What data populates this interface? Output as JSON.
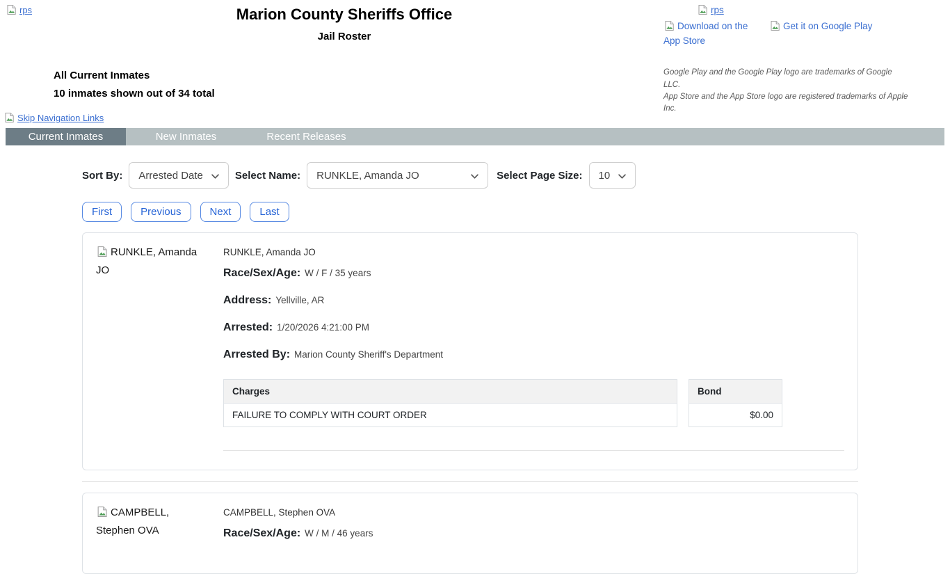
{
  "header": {
    "logo_alt": "rps",
    "title": "Marion County Sheriffs Office",
    "subtitle": "Jail Roster",
    "store_rps_alt": "rps",
    "app_store_alt": "Download on the App Store",
    "google_play_alt": "Get it on Google Play",
    "trademark_line1": "Google Play and the Google Play logo are trademarks of Google LLC.",
    "trademark_line2": "App Store and the App Store logo are registered trademarks of Apple Inc."
  },
  "summary": {
    "heading": "All Current Inmates",
    "count_text": "10 inmates shown out of 34 total"
  },
  "skip_link_label": "Skip Navigation Links",
  "tabs": [
    {
      "label": "Current Inmates",
      "active": true
    },
    {
      "label": "New Inmates",
      "active": false
    },
    {
      "label": "Recent Releases",
      "active": false
    }
  ],
  "controls": {
    "sort_by_label": "Sort By:",
    "sort_by_value": "Arrested Date",
    "select_name_label": "Select Name:",
    "select_name_value": "RUNKLE, Amanda JO",
    "page_size_label": "Select Page Size:",
    "page_size_value": "10"
  },
  "pagination": {
    "first": "First",
    "previous": "Previous",
    "next": "Next",
    "last": "Last"
  },
  "inmates": [
    {
      "photo_alt": "RUNKLE, Amanda JO",
      "name": "RUNKLE, Amanda JO",
      "race_sex_age_label": "Race/Sex/Age:",
      "race_sex_age": "W / F / 35 years",
      "address_label": "Address:",
      "address": "Yellville, AR",
      "arrested_label": "Arrested:",
      "arrested": "1/20/2026 4:21:00 PM",
      "arrested_by_label": "Arrested By:",
      "arrested_by": "Marion County Sheriff's Department",
      "charges_header": "Charges",
      "bond_header": "Bond",
      "charges": [
        {
          "charge": "FAILURE TO COMPLY WITH COURT ORDER",
          "bond": "$0.00"
        }
      ]
    },
    {
      "photo_alt": "CAMPBELL, Stephen OVA",
      "name": "CAMPBELL, Stephen OVA",
      "race_sex_age_label": "Race/Sex/Age:",
      "race_sex_age": "W / M / 46 years"
    }
  ],
  "icons": {
    "broken_image": "broken-image-icon",
    "chevron": "chevron-down-icon"
  },
  "colors": {
    "link_blue": "#3b6fd1",
    "tab_bar_bg": "#b6c0c2",
    "tab_active_bg": "#6d7d86",
    "tab_text": "#ffffff",
    "button_blue": "#2563d6",
    "table_header_bg": "#f2f2f2",
    "card_border": "#dee2e6"
  }
}
